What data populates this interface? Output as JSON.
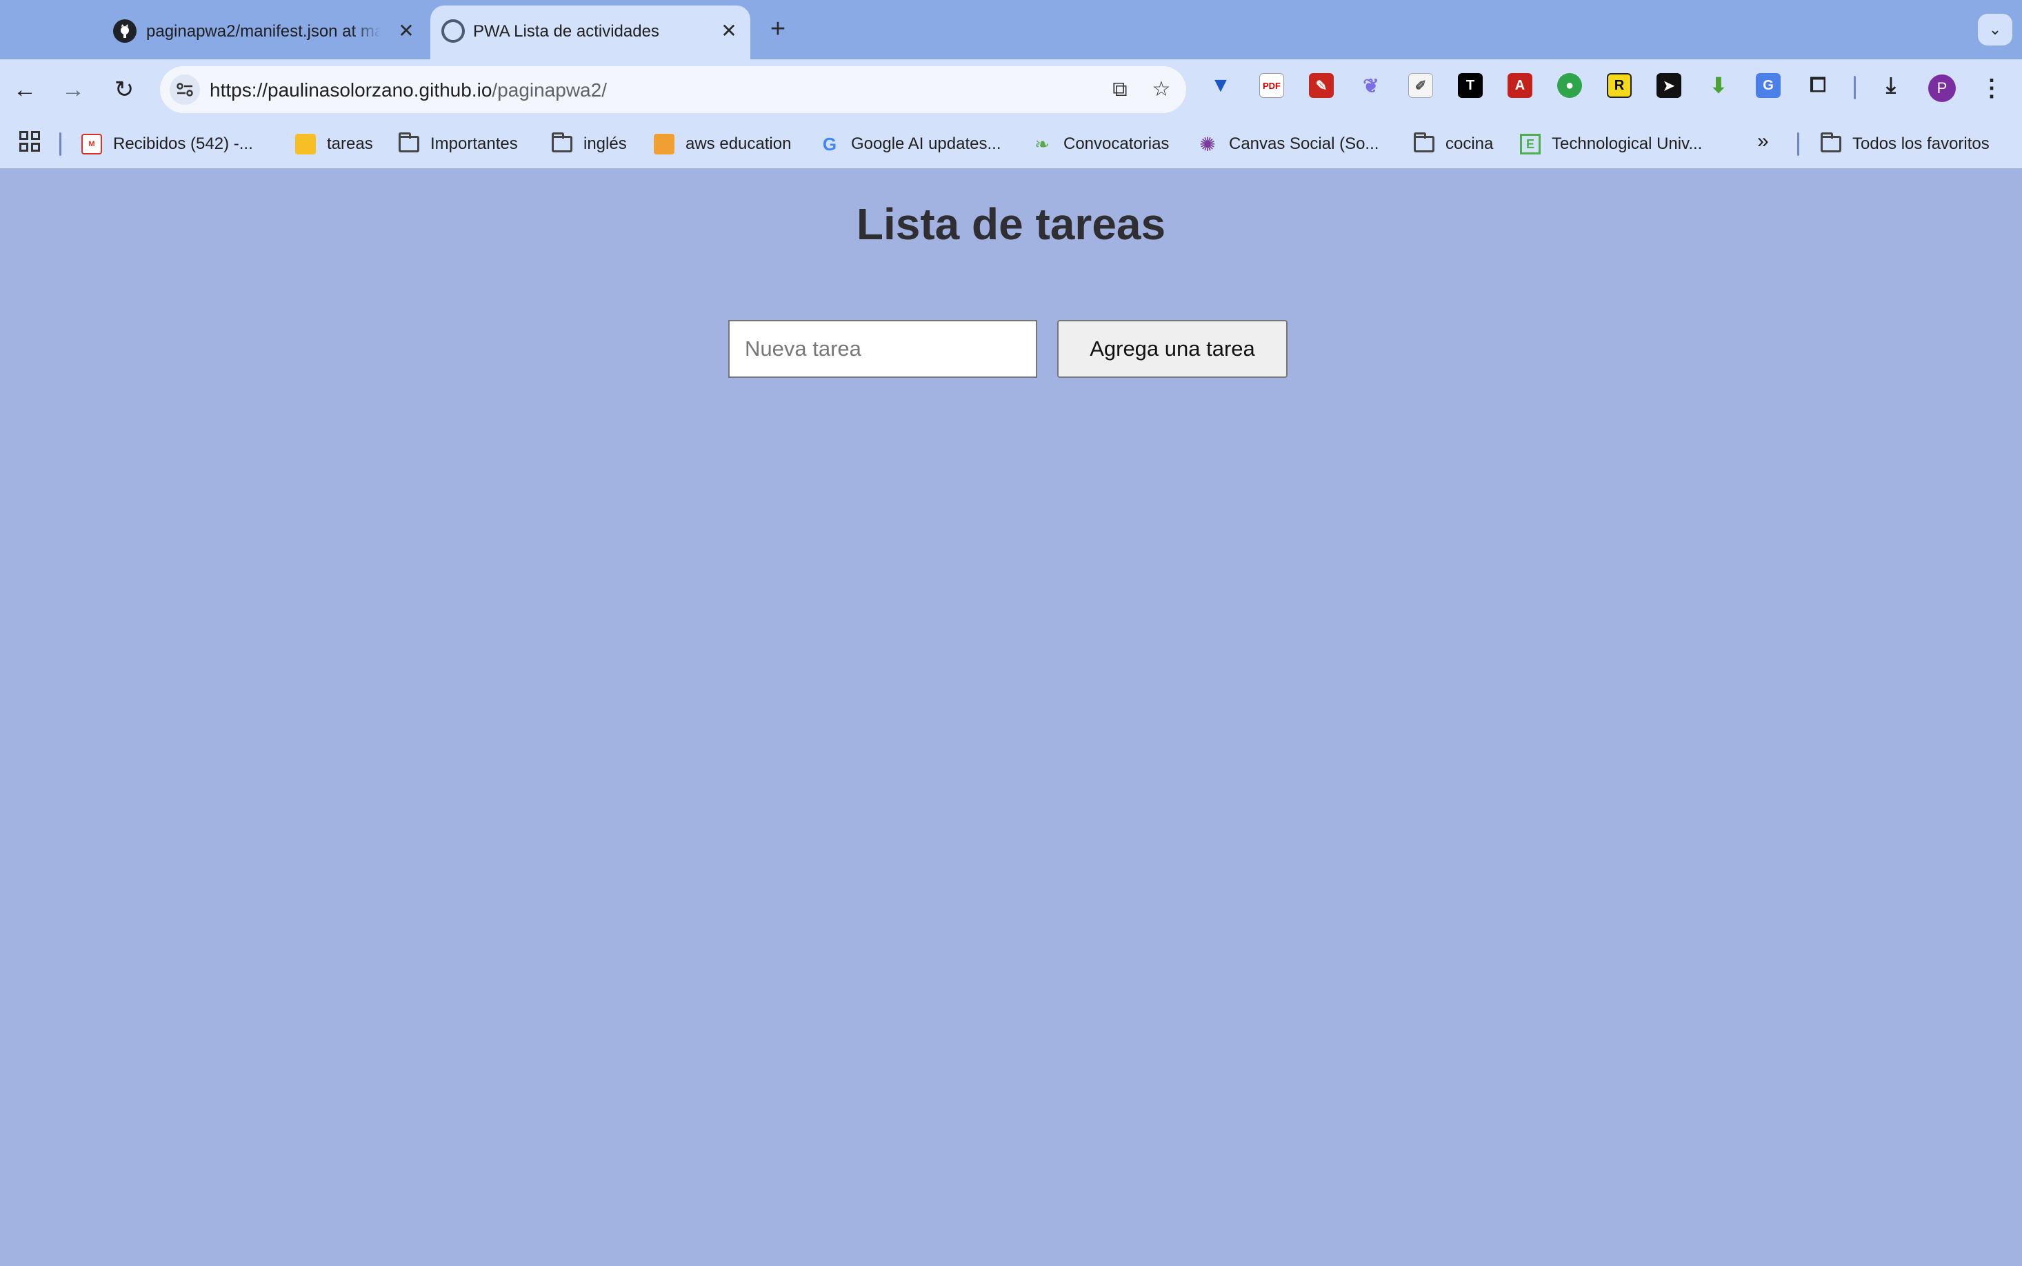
{
  "browser": {
    "tabs": [
      {
        "title": "paginapwa2/manifest.json at main",
        "favicon": "github-icon",
        "active": false
      },
      {
        "title": "PWA Lista de actividades",
        "favicon": "globe-icon",
        "active": true
      }
    ],
    "new_tab_label": "+",
    "url_host": "https://paulinasolorzano.github.io",
    "url_path": "/paginapwa2/",
    "bookmarks": [
      {
        "label": "Recibidos (542) -...",
        "icon": "gmail-icon"
      },
      {
        "label": "tareas",
        "icon": "keep-icon"
      },
      {
        "label": "Importantes",
        "icon": "folder-icon"
      },
      {
        "label": "inglés",
        "icon": "folder-icon"
      },
      {
        "label": "aws education",
        "icon": "aws-icon"
      },
      {
        "label": "Google AI updates...",
        "icon": "google-icon"
      },
      {
        "label": "Convocatorias",
        "icon": "leaf-icon"
      },
      {
        "label": "Canvas Social (So...",
        "icon": "canvas-icon"
      },
      {
        "label": "cocina",
        "icon": "folder-icon"
      },
      {
        "label": "Technological Univ...",
        "icon": "e-icon"
      }
    ],
    "all_bookmarks_label": "Todos los favoritos",
    "profile_initial": "P",
    "colors": {
      "frame": "#8aaae6",
      "toolbar": "#d3e1fb",
      "page_bg": "#a2b3e1"
    }
  },
  "page": {
    "title": "Lista de tareas",
    "input_placeholder": "Nueva tarea",
    "input_value": "",
    "add_button_label": "Agrega una tarea"
  }
}
